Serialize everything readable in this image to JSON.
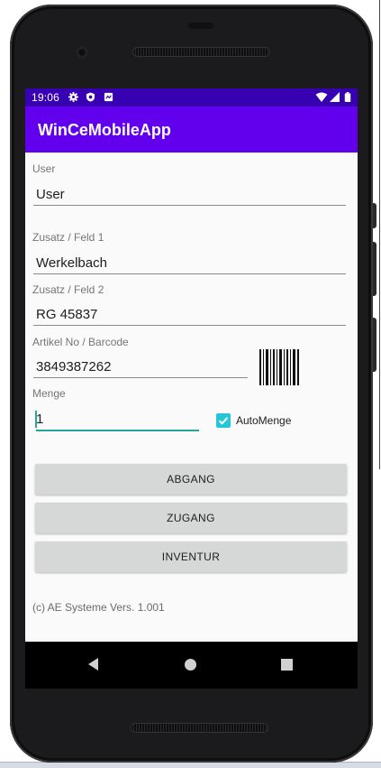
{
  "status_bar": {
    "time": "19:06",
    "left_icons": [
      "gear-icon",
      "shield-icon",
      "notification-icon"
    ],
    "right_icons": [
      "wifi-icon",
      "signal-icon",
      "battery-icon"
    ]
  },
  "app_bar": {
    "title": "WinCeMobileApp"
  },
  "form": {
    "user": {
      "label": "User",
      "value": "User"
    },
    "zusatz1": {
      "label": "Zusatz / Feld 1",
      "value": "Werkelbach"
    },
    "zusatz2": {
      "label": "Zusatz / Feld 2",
      "value": "RG 45837"
    },
    "artikel": {
      "label": "Artikel No / Barcode",
      "value": "3849387262"
    },
    "menge": {
      "label": "Menge",
      "value": "1"
    },
    "automenge": {
      "label": "AutoMenge",
      "checked": true
    }
  },
  "buttons": {
    "abgang": "ABGANG",
    "zugang": "ZUGANG",
    "inventur": "INVENTUR"
  },
  "footer": {
    "text": "(c) AE Systeme Vers. 1.001"
  },
  "colors": {
    "status_bar": "#3700b3",
    "app_bar": "#6200ee",
    "accent": "#26a69a",
    "checkbox": "#26c6da",
    "button": "#d6d7d7"
  }
}
